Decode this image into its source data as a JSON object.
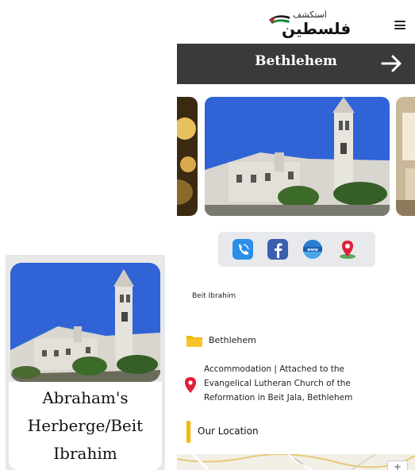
{
  "card": {
    "title": "Abraham's Herberge/Beit Ibrahim"
  },
  "header": {
    "logo_small": "استكشف",
    "logo_big": "فلسطين",
    "menu_icon": "hamburger-icon"
  },
  "city": {
    "name": "Bethlehem",
    "arrow_icon": "arrow-right-icon"
  },
  "contact_icons": [
    "viber-icon",
    "facebook-icon",
    "www-icon",
    "map-pin-icon"
  ],
  "place": {
    "name": "Beit Ibrahim",
    "city": "Bethlehem",
    "description": "Accommodation | Attached to the Evangelical Lutheran Church of the Reformation in Beit Jala, Bethlehem",
    "location_heading": "Our Location"
  },
  "map": {
    "zoom_in": "+"
  },
  "colors": {
    "band": "#3a3a3a",
    "accent_yellow": "#f5b800",
    "pin_red": "#e0203a",
    "sky": "#2f63d6"
  }
}
